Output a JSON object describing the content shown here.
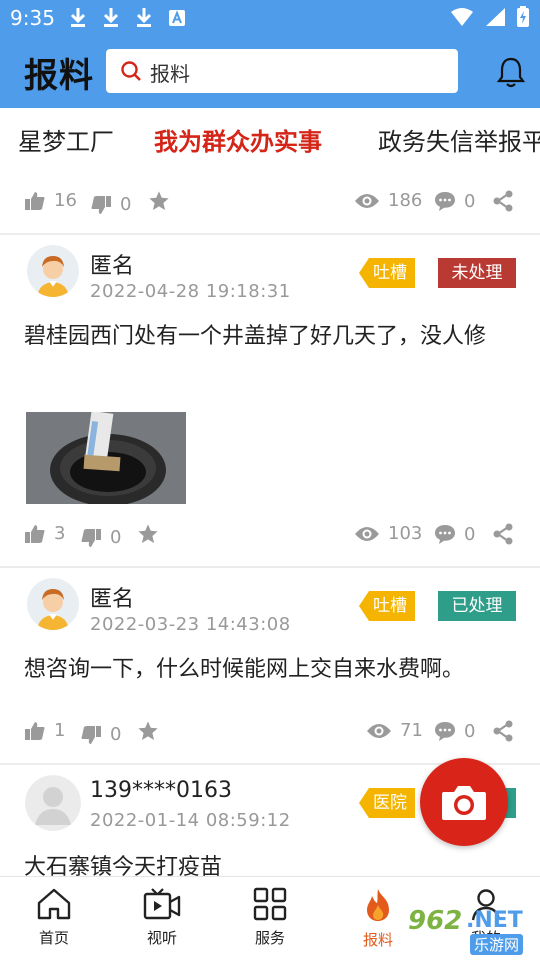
{
  "status_bar": {
    "time": "9:35"
  },
  "header": {
    "title": "报料",
    "search_text": "报料"
  },
  "tabs": [
    "星梦工厂",
    "我为群众办实事",
    "政务失信举报平"
  ],
  "top_actions": {
    "likes": "16",
    "dislikes": "0",
    "views": "186",
    "comments": "0"
  },
  "posts": [
    {
      "author": "匿名",
      "time": "2022-04-28  19:18:31",
      "category": "吐槽",
      "status": "未处理",
      "content": "碧桂园西门处有一个井盖掉了好几天了，没人修",
      "likes": "3",
      "dislikes": "0",
      "views": "103",
      "comments": "0"
    },
    {
      "author": "匿名",
      "time": "2022-03-23  14:43:08",
      "category": "吐槽",
      "status": "已处理",
      "content": "想咨询一下，什么时候能网上交自来水费啊。",
      "likes": "1",
      "dislikes": "0",
      "views": "71",
      "comments": "0"
    },
    {
      "author": "139****0163",
      "time": "2022-01-14  08:59:12",
      "category": "医院",
      "content": "大石寨镇今天打疫苗"
    }
  ],
  "bottom_nav": [
    "首页",
    "视听",
    "服务",
    "报料",
    "我的"
  ],
  "watermark": {
    "num": "962",
    "net": ".NET",
    "sub": "乐游网"
  },
  "colors": {
    "brand_blue": "#4f9cea",
    "active_red": "#d42518",
    "fab_red": "#d9241a",
    "tag_yellow": "#f5b400",
    "status_red": "#b83a32",
    "status_green": "#2e9e8a",
    "nav_active": "#e35b1c"
  },
  "icons": [
    "download-icon",
    "translate-icon",
    "wifi-icon",
    "signal-icon",
    "battery-icon",
    "search-icon",
    "bell-icon",
    "thumbs-up-icon",
    "thumbs-down-icon",
    "star-icon",
    "eye-icon",
    "comment-icon",
    "share-icon",
    "camera-icon",
    "home-icon",
    "video-icon",
    "grid-icon",
    "fire-icon",
    "user-icon"
  ]
}
